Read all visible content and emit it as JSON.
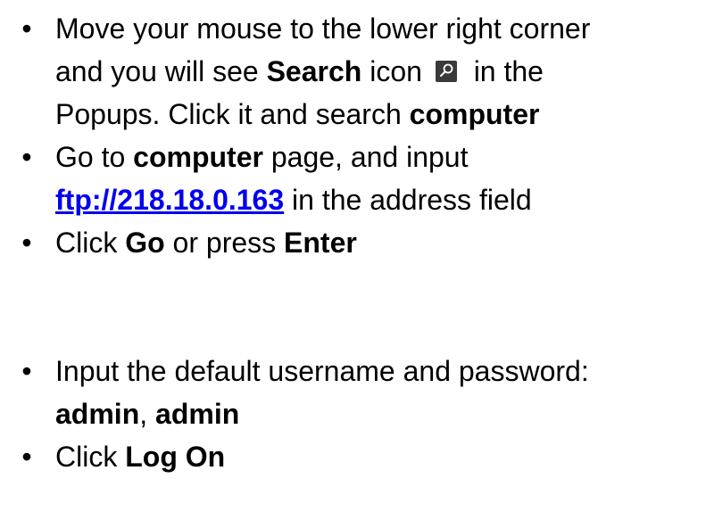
{
  "steps": [
    {
      "lines": [
        {
          "parts": [
            {
              "t": "Move your mouse to the lower right corner"
            }
          ]
        },
        {
          "parts": [
            {
              "t": "and you will see "
            },
            {
              "t": "Search",
              "b": true
            },
            {
              "t": " icon "
            },
            {
              "icon": "search-icon"
            },
            {
              "t": " in the"
            }
          ]
        },
        {
          "parts": [
            {
              "t": "Popups. Click it and search "
            },
            {
              "t": "computer",
              "b": true
            }
          ]
        }
      ]
    },
    {
      "lines": [
        {
          "parts": [
            {
              "t": "Go to "
            },
            {
              "t": "computer",
              "b": true
            },
            {
              "t": " page, and input"
            }
          ]
        },
        {
          "parts": [
            {
              "t": "ftp://218.18.0.163",
              "link": true
            },
            {
              "t": " in the address field"
            }
          ]
        }
      ]
    },
    {
      "lines": [
        {
          "parts": [
            {
              "t": "Click "
            },
            {
              "t": "Go",
              "b": true
            },
            {
              "t": " or press "
            },
            {
              "t": "Enter",
              "b": true
            }
          ]
        }
      ]
    },
    {
      "lines": [
        {
          "justify": true,
          "parts": [
            {
              "t": "Input the default username and password:"
            }
          ]
        },
        {
          "parts": [
            {
              "t": "admin",
              "b": true
            },
            {
              "t": ", "
            },
            {
              "t": "admin",
              "b": true
            }
          ]
        }
      ]
    },
    {
      "lines": [
        {
          "parts": [
            {
              "t": "Click "
            },
            {
              "t": "Log On",
              "b": true
            }
          ]
        }
      ]
    }
  ],
  "bullet_glyph": "•",
  "icon_colors": {
    "search_icon_bg": "#3a3a3a",
    "search_icon_fg": "#ffffff"
  },
  "link_color": "#0000ee"
}
